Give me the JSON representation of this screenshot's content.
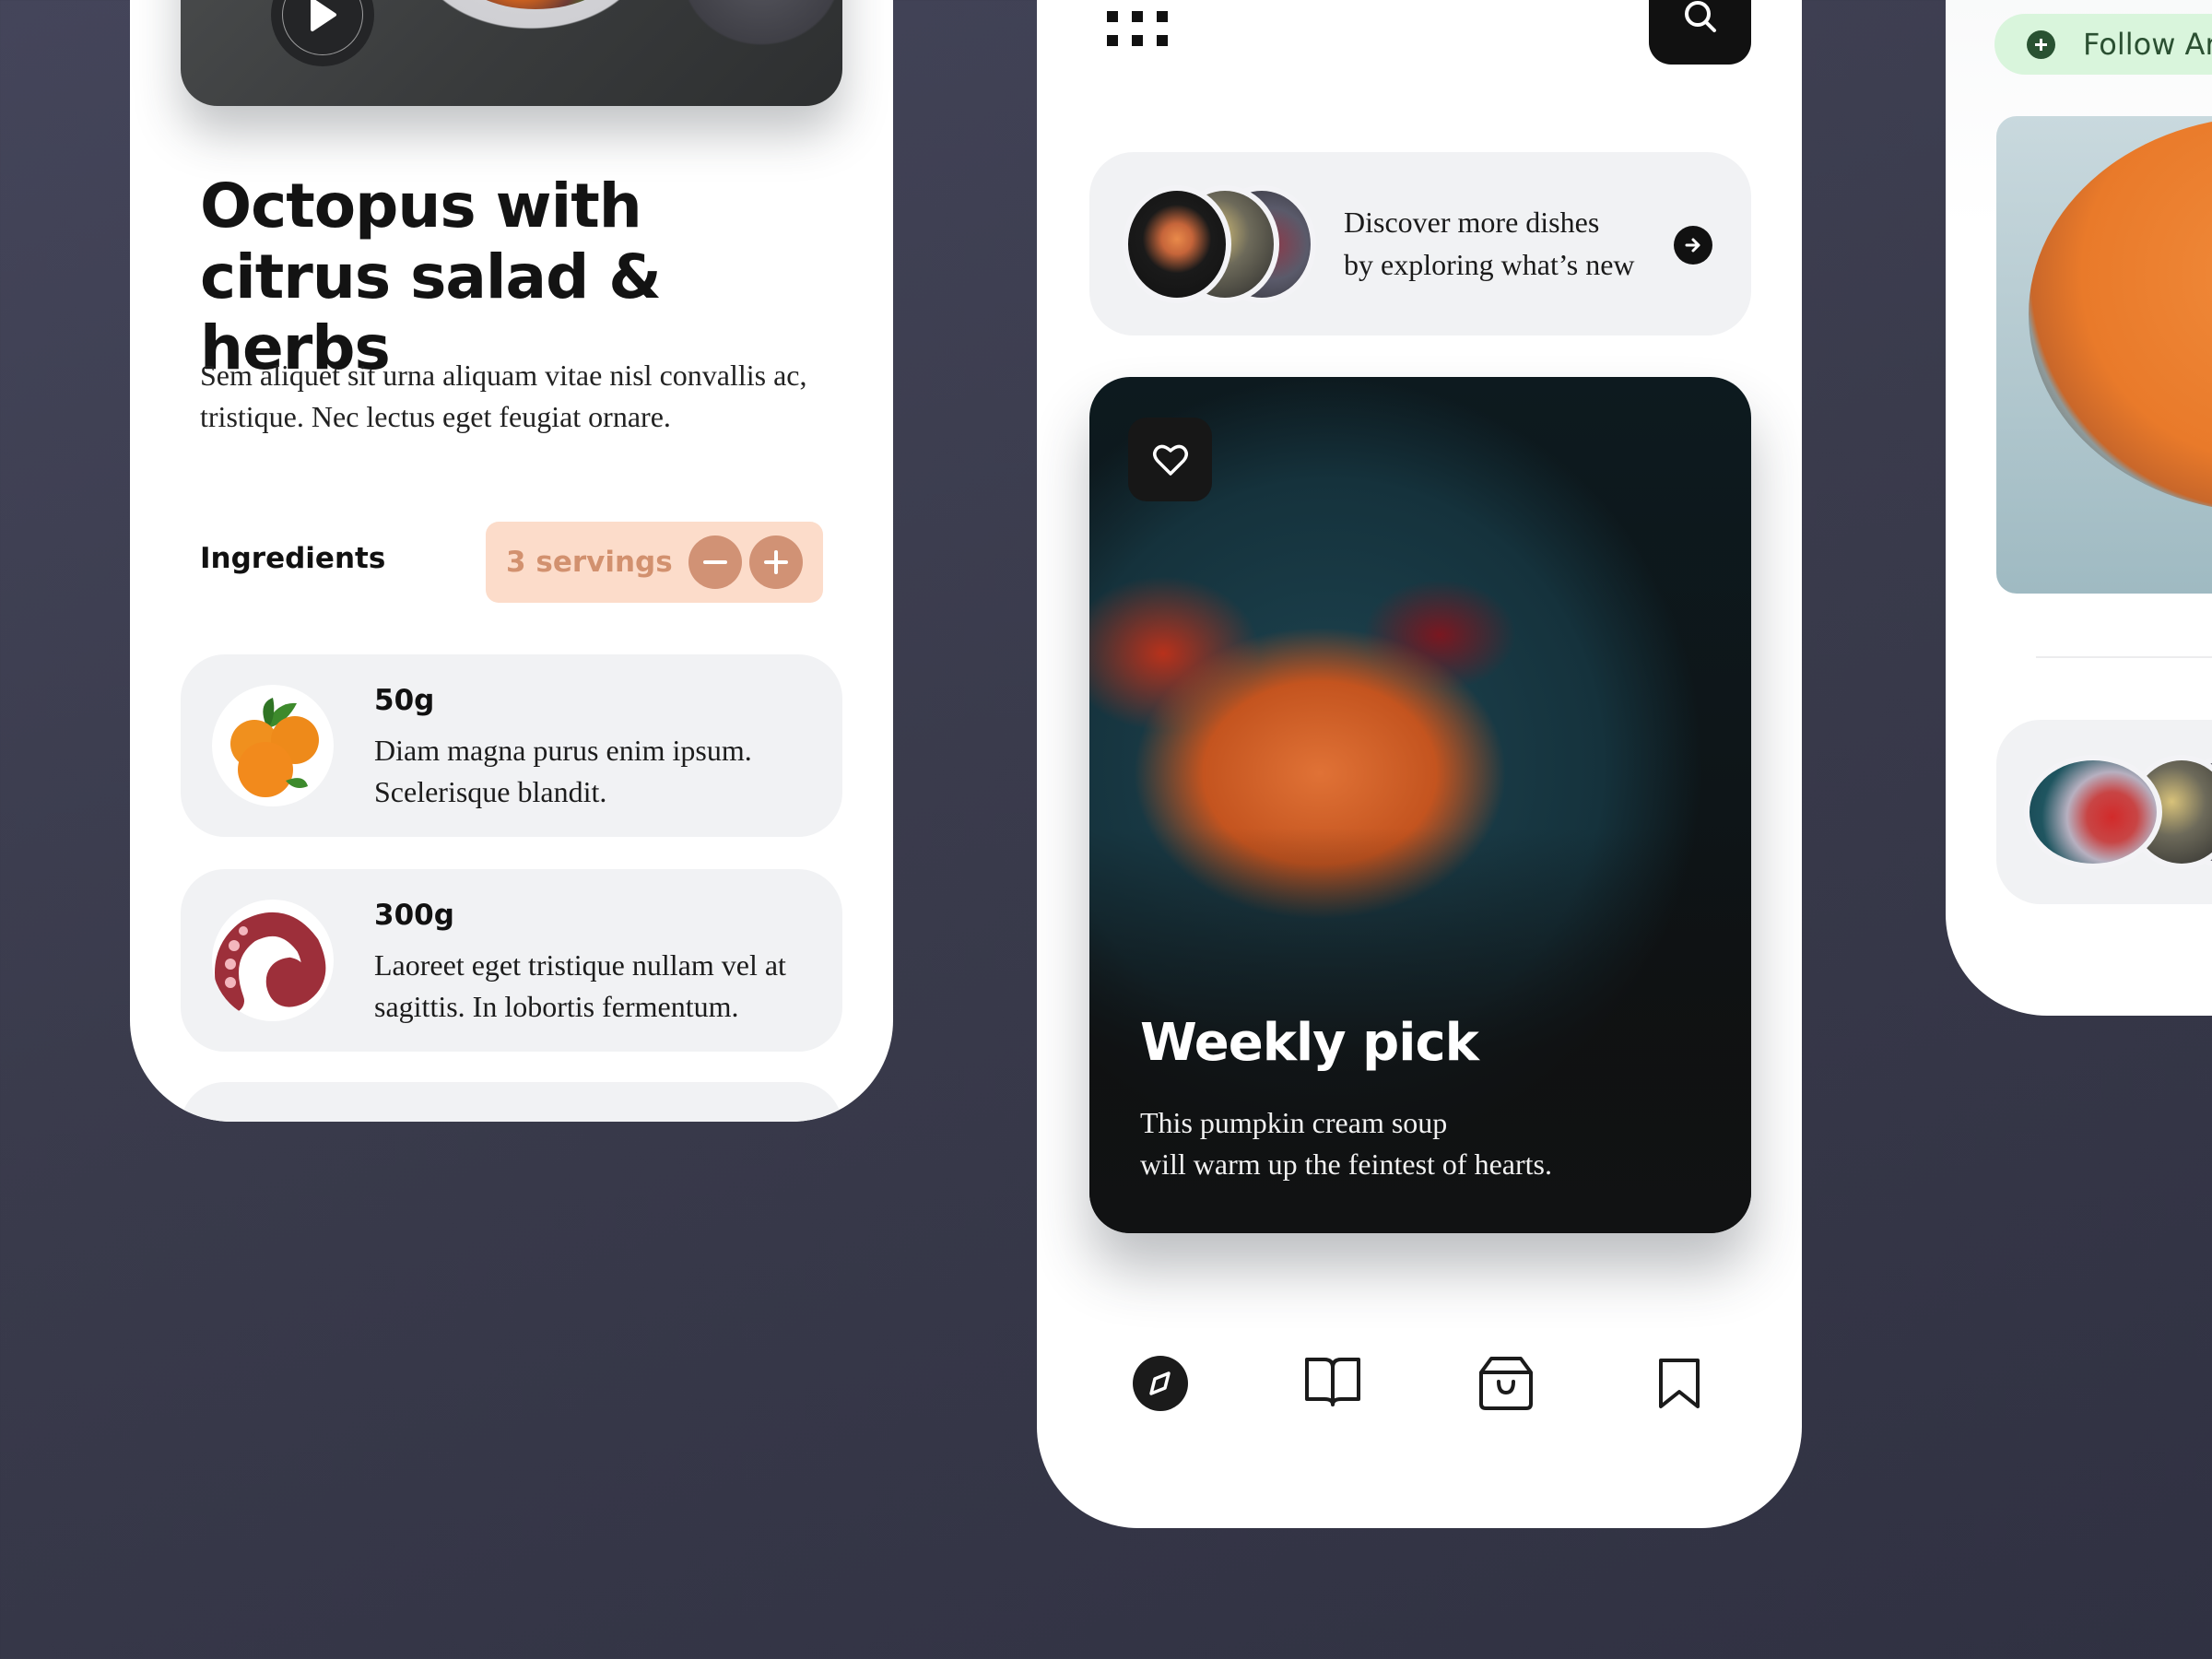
{
  "background_color": "#3b3c4d",
  "recipe_screen": {
    "play_button_label": "Play video",
    "title": "Octopus with citrus salad & herbs",
    "description": "Sem aliquet sit urna aliquam vitae nisl convallis ac, tristique. Nec lectus eget feugiat ornare.",
    "ingredients_label": "Ingredients",
    "servings": {
      "label": "3 servings",
      "value": 3,
      "decrement_icon": "minus-icon",
      "increment_icon": "plus-icon",
      "accent_color": "#d19275",
      "background_color": "#fcdcca"
    },
    "ingredients": [
      {
        "amount": "50g",
        "text": "Diam magna purus enim ipsum. Scelerisque blandit.",
        "image": "oranges"
      },
      {
        "amount": "300g",
        "text": "Laoreet eget tristique nullam vel at sagittis. In lobortis fermentum.",
        "image": "octopus-tentacle"
      }
    ]
  },
  "explore_screen": {
    "menu_icon": "grid-dots-icon",
    "search_icon": "search-icon",
    "discover": {
      "line1": "Discover more dishes",
      "line2": "by exploring what’s new",
      "arrow_icon": "arrow-right-icon"
    },
    "weekly_pick": {
      "title": "Weekly pick",
      "line1": "This pumpkin cream soup",
      "line2": "will warm up the feintest of hearts.",
      "favorite_icon": "heart-icon"
    },
    "bottom_nav": [
      {
        "name": "explore",
        "icon": "compass-icon",
        "active": true
      },
      {
        "name": "recipes",
        "icon": "book-icon",
        "active": false
      },
      {
        "name": "shop",
        "icon": "shopping-bag-icon",
        "active": false
      },
      {
        "name": "saved",
        "icon": "bookmark-icon",
        "active": false
      }
    ]
  },
  "profile_screen": {
    "follow_label": "Follow Ar",
    "follow_color": "#2b5032",
    "follow_bg": "#d9f5dc"
  }
}
